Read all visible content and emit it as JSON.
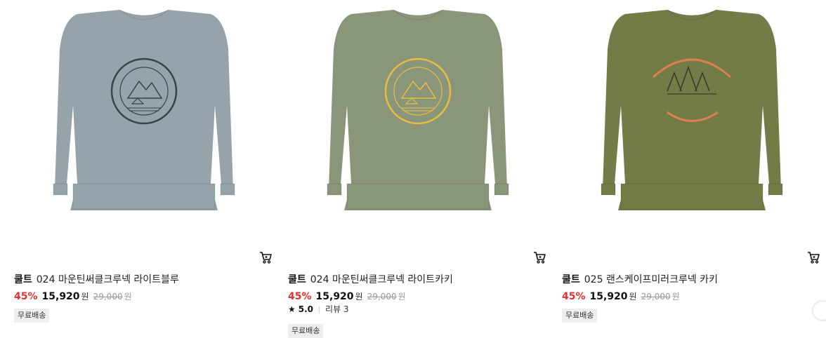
{
  "products": [
    {
      "brand": "쿨트",
      "name": "024 마운틴써클크루넥 라이트블루",
      "discount": "45%",
      "price": "15,920",
      "currency": "원",
      "original_price": "29,000",
      "original_currency": "원",
      "badge": "무료배송",
      "garment_color": "#95a4aa",
      "print_color": "#3a4246"
    },
    {
      "brand": "쿨트",
      "name": "024 마운틴써클크루넥 라이트카키",
      "discount": "45%",
      "price": "15,920",
      "currency": "원",
      "original_price": "29,000",
      "original_currency": "원",
      "rating_icon": "star-icon",
      "rating": "5.0",
      "reviews": "리뷰 3",
      "badge": "무료배송",
      "garment_color": "#8a967a",
      "print_color": "#e7bd45"
    },
    {
      "brand": "쿨트",
      "name": "025 랜스케이프미러크루넥 카키",
      "discount": "45%",
      "price": "15,920",
      "currency": "원",
      "original_price": "29,000",
      "original_currency": "원",
      "badge": "무료배송",
      "garment_color": "#737b47",
      "print_color": "#d9824e"
    }
  ],
  "icons": {
    "cart": "cart-icon",
    "scroll": "next-arrow-icon"
  }
}
